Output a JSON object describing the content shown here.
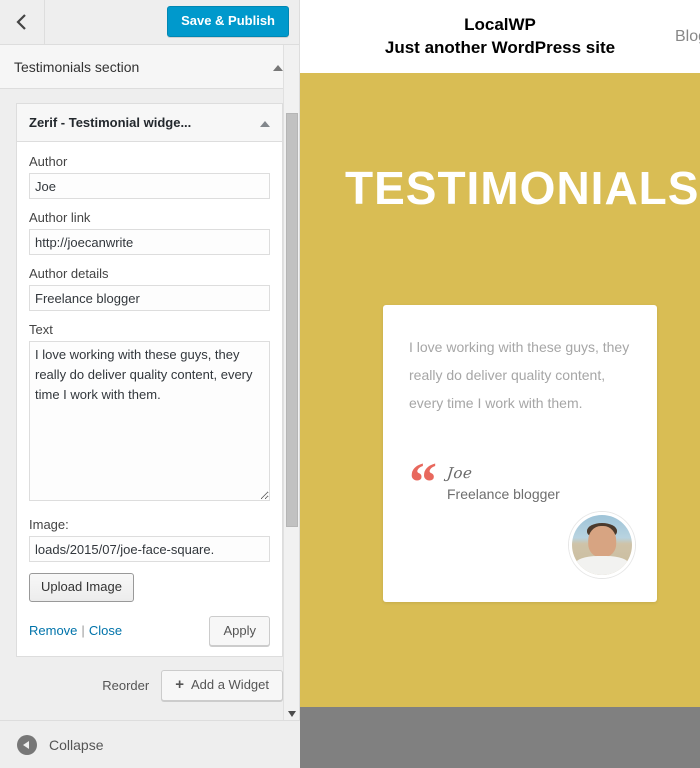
{
  "sidebar": {
    "back_icon": "chevron-left-icon",
    "save_label": "Save & Publish",
    "section": {
      "title": "Testimonials section",
      "collapse_icon": "caret-up-icon"
    },
    "widget": {
      "title": "Zerif - Testimonial widge...",
      "collapse_icon": "caret-up-icon",
      "fields": {
        "author_label": "Author",
        "author_value": "Joe",
        "author_link_label": "Author link",
        "author_link_value": "http://joecanwrite",
        "author_details_label": "Author details",
        "author_details_value": "Freelance blogger",
        "text_label": "Text",
        "text_value": "I love working with these guys, they really do deliver quality content, every time I work with them.",
        "image_label": "Image:",
        "image_value": "loads/2015/07/joe-face-square.",
        "upload_label": "Upload Image"
      },
      "remove_label": "Remove",
      "separator": "|",
      "close_label": "Close",
      "apply_label": "Apply"
    },
    "reorder_label": "Reorder",
    "add_widget_label": "Add a Widget",
    "add_widget_icon": "plus-icon",
    "collapse_label": "Collapse",
    "collapse_icon": "collapse-arrow-icon"
  },
  "preview": {
    "site_title": "LocalWP",
    "site_description": "Just another WordPress site",
    "nav": [
      {
        "label": "Blog"
      }
    ],
    "testimonials": {
      "heading": "TESTIMONIALS",
      "card": {
        "text": "I love working with these guys, they really do deliver quality content, every time I work with them.",
        "quote_icon": "quote-mark-icon",
        "author": "Joe",
        "role": "Freelance blogger",
        "avatar_alt": "joe-face-square"
      }
    }
  },
  "colors": {
    "accent_blue": "#0099cc",
    "section_yellow": "#d9bd54",
    "quote_coral": "#e8685d",
    "footer_gray": "#808080",
    "link_blue": "#0073aa"
  }
}
